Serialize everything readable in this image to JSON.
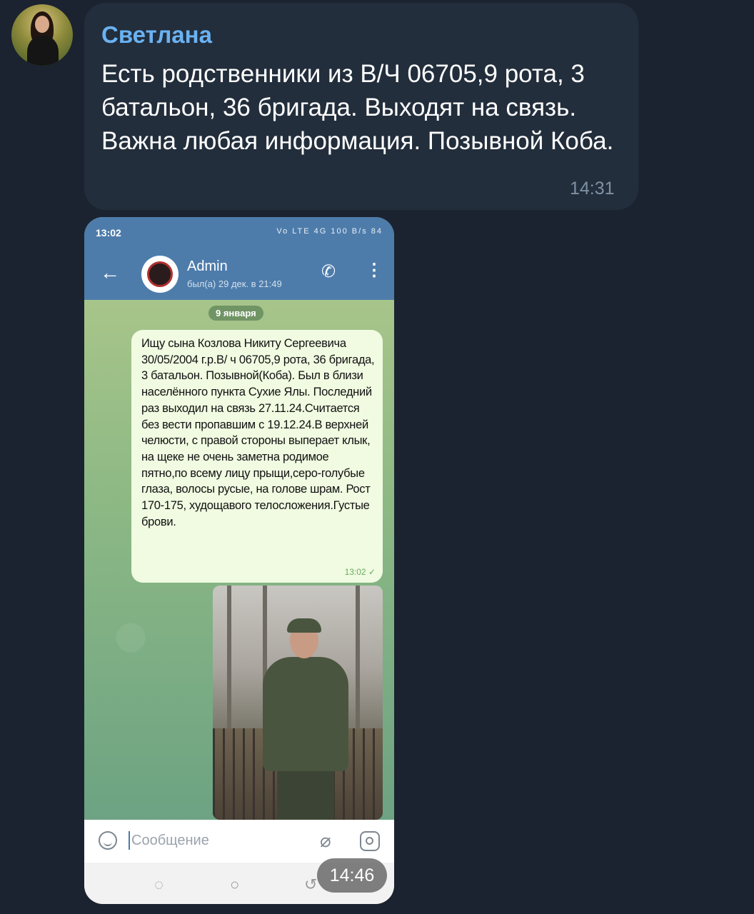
{
  "message": {
    "sender": "Светлана",
    "text": "Есть родственники из В/Ч 06705,9 рота, 3 батальон, 36 бригада. Выходят на связь. Важна любая информация. Позывной Коба.",
    "time": "14:31"
  },
  "photo": {
    "status_time": "13:02",
    "status_indicators": "Vo LTE 4G 100 B/s 84",
    "chat_name": "Admin",
    "last_seen": "был(а) 29 дек. в 21:49",
    "date_badge": "9 января",
    "bubble_text": "Ищу сына Козлова Никиту Сергеевича 30/05/2004 г.р.В/ ч 06705,9 рота, 36 бригада, 3 батальон. Позывной(Коба). Был в близи населённого пункта Сухие Ялы. Последний раз выходил на связь 27.11.24.Считается без вести пропавшим с 19.12.24.В верхней челюсти, с правой стороны выперает клык, на щеке не очень заметна родимое пятно,по всему лицу прыщи,серо-голубые глаза, волосы русые, на голове шрам. Рост 170-175, худощавого телосложения.Густые брови.",
    "bubble_time": "13:02 ✓",
    "input_placeholder": "Сообщение",
    "timestamp": "14:46"
  },
  "icons": {
    "back": "arrow-left-icon",
    "call": "phone-icon",
    "menu": "more-vertical-icon",
    "emoji": "smile-icon",
    "attach": "paperclip-icon",
    "camera": "camera-icon"
  },
  "colors": {
    "background": "#1b2330",
    "bubble": "#232e3c",
    "sender": "#6ab2f2",
    "phone_header": "#4d7cab",
    "phone_bubble": "#f0fbe1"
  }
}
